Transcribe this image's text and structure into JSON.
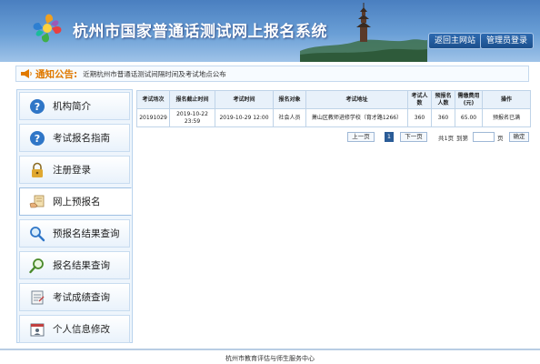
{
  "header": {
    "title": "杭州市国家普通话测试网上报名系统",
    "back_button": "返回主网站",
    "admin_button": "管理员登录"
  },
  "notice": {
    "label": "通知公告:",
    "text": "近期杭州市普通话测试间隔时间及考试地点公布"
  },
  "sidebar": {
    "items": [
      {
        "label": "机构简介",
        "icon": "question-icon"
      },
      {
        "label": "考试报名指南",
        "icon": "question-icon"
      },
      {
        "label": "注册登录",
        "icon": "lock-icon"
      },
      {
        "label": "网上预报名",
        "icon": "hand-register-icon"
      },
      {
        "label": "预报名结果查询",
        "icon": "magnifier-icon"
      },
      {
        "label": "报名结果查询",
        "icon": "magnifier-icon"
      },
      {
        "label": "考试成绩查询",
        "icon": "document-icon"
      },
      {
        "label": "个人信息修改",
        "icon": "calendar-person-icon"
      }
    ],
    "active_index": 3
  },
  "table": {
    "headers": [
      "考试场次",
      "报名截止时间",
      "考试时间",
      "报名对象",
      "考试地址",
      "考试人数",
      "预报名人数",
      "需缴费用(元)",
      "操作"
    ],
    "rows": [
      [
        "20191029",
        "2019-10-22 23:59",
        "2019-10-29 12:00",
        "社会人员",
        "萧山区教师进修学校（育才路1266）",
        "360",
        "360",
        "65.00",
        "预报名已满"
      ]
    ]
  },
  "pager": {
    "prev": "上一页",
    "current": "1",
    "next": "下一页",
    "total": "共1页",
    "goto": "到第",
    "page_unit": "页",
    "confirm": "确定"
  },
  "footer": {
    "text": "杭州市教育评估与师生服务中心"
  },
  "colors": {
    "header_blue": "#4a7fc0",
    "notice_orange": "#e07a00",
    "current_page": "#2b5c97"
  }
}
